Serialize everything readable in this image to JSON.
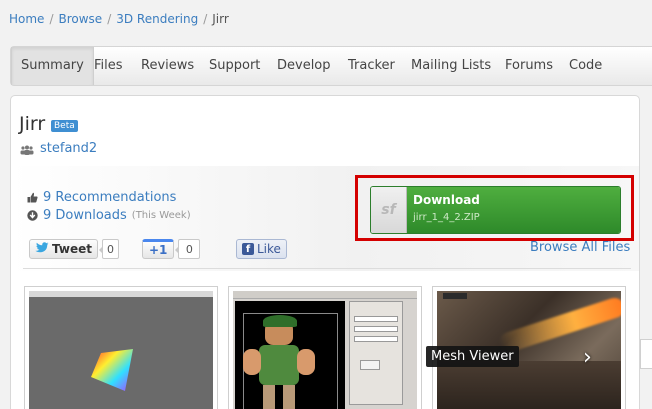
{
  "breadcrumb": [
    "Home",
    "Browse",
    "3D Rendering",
    "Jirr"
  ],
  "tabs": [
    {
      "label": "Summary",
      "active": true
    },
    {
      "label": "Files",
      "active": false
    },
    {
      "label": "Reviews",
      "active": false
    },
    {
      "label": "Support",
      "active": false
    },
    {
      "label": "Develop",
      "active": false
    },
    {
      "label": "Tracker",
      "active": false
    },
    {
      "label": "Mailing Lists",
      "active": false
    },
    {
      "label": "Forums",
      "active": false
    },
    {
      "label": "Code",
      "active": false
    }
  ],
  "project": {
    "name": "Jirr",
    "badge": "Beta",
    "author": "stefand2"
  },
  "stats": {
    "recommendations": "9 Recommendations",
    "downloads": "9 Downloads",
    "downloads_period": "(This Week)"
  },
  "share": {
    "tweet_label": "Tweet",
    "tweet_count": "0",
    "plus_label": "+1",
    "plus_count": "0",
    "like_label": "Like"
  },
  "download": {
    "logo_text": "sf",
    "title": "Download",
    "filename": "jirr_1_4_2.ZIP",
    "browse_all": "Browse All Files"
  },
  "gallery": {
    "caption": "Mesh Viewer",
    "next_icon": "chevron-right-icon"
  },
  "colors": {
    "link": "#3b7dbf",
    "download_green": "#3f9e35",
    "highlight_red": "#d40000",
    "beta_blue": "#3f8fd2"
  }
}
